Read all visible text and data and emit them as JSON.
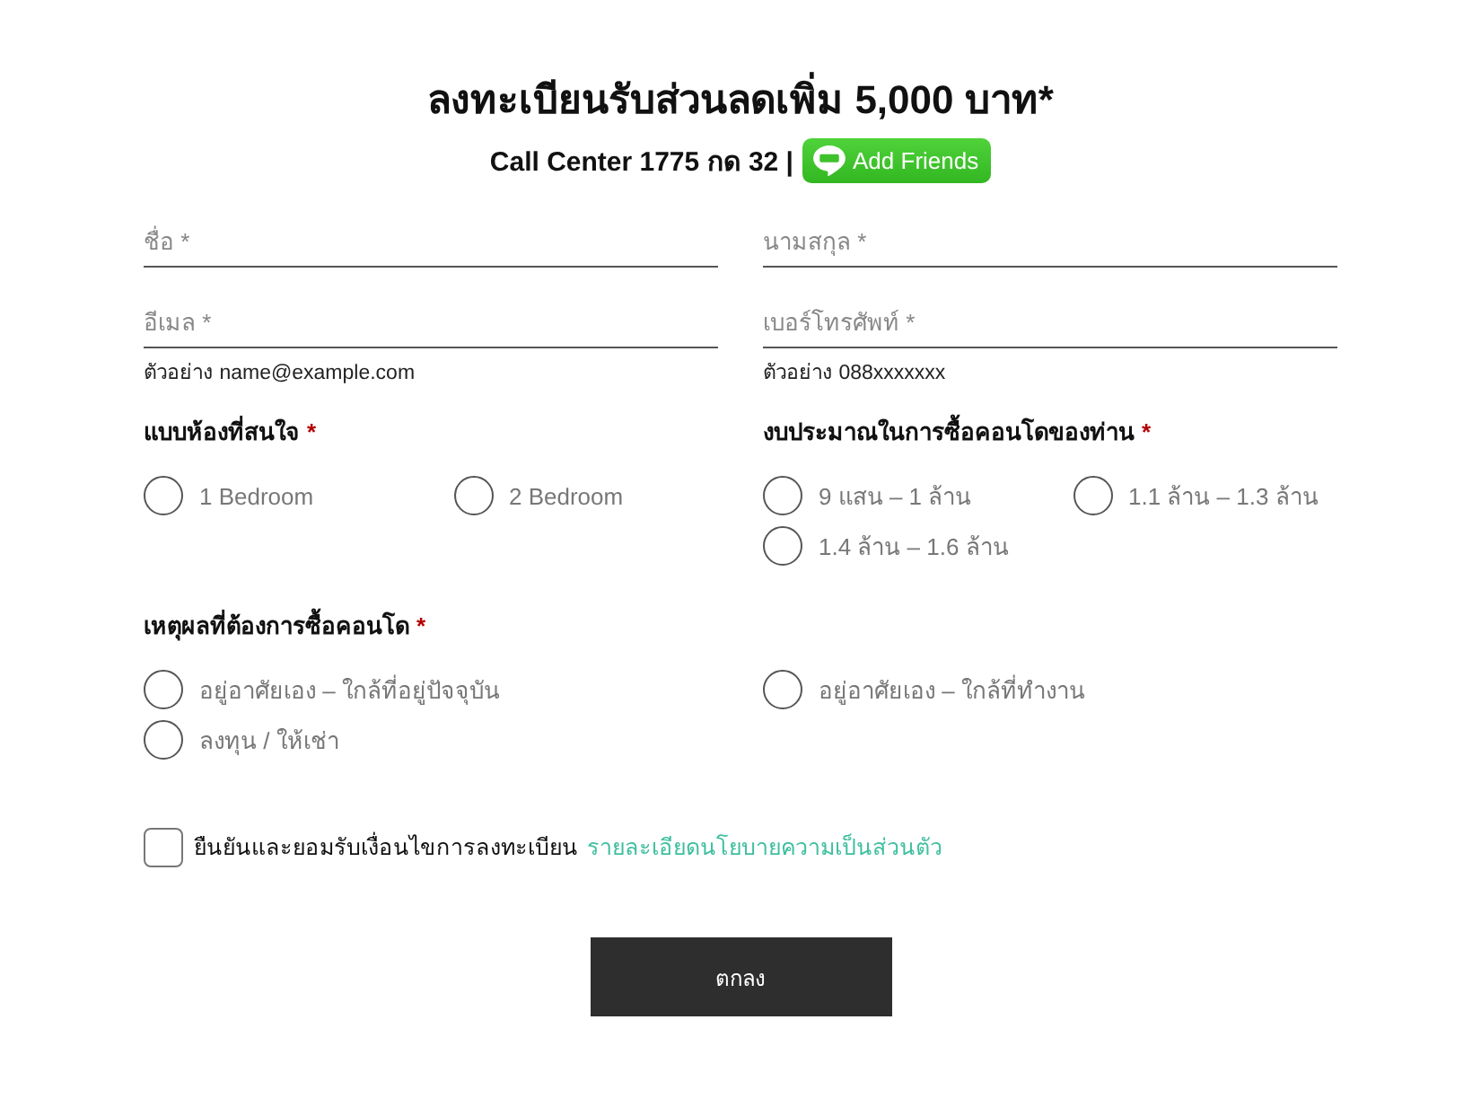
{
  "title": "ลงทะเบียนรับส่วนลดเพิ่ม 5,000 บาท*",
  "contact": {
    "text": "Call Center 1775 กด 32 |",
    "button": "Add Friends"
  },
  "fields": [
    {
      "placeholder": "ชื่อ *"
    },
    {
      "placeholder": "นามสกุล *"
    },
    {
      "placeholder": "อีเมล *",
      "hint": "ตัวอย่าง name@example.com"
    },
    {
      "placeholder": "เบอร์โทรศัพท์ *",
      "hint": "ตัวอย่าง 088xxxxxxx"
    }
  ],
  "question_rows": [
    {
      "questions": [
        {
          "heading": "แบบห้องที่สนใจ",
          "required_mark": "*",
          "options": [
            {
              "label": "1 Bedroom",
              "selected": false
            },
            {
              "label": "2 Bedroom",
              "selected": false
            }
          ]
        },
        {
          "heading": "งบประมาณในการซื้อคอนโดของท่าน",
          "required_mark": "*",
          "options": [
            {
              "label": "9 แสน – 1 ล้าน",
              "selected": false
            },
            {
              "label": "1.1 ล้าน – 1.3 ล้าน",
              "selected": false
            },
            {
              "label": "1.4 ล้าน – 1.6 ล้าน",
              "selected": false
            }
          ]
        }
      ]
    },
    {
      "questions": [
        {
          "heading": "เหตุผลที่ต้องการซื้อคอนโด",
          "required_mark": "*",
          "options": [
            {
              "label": "อยู่อาศัยเอง – ใกล้ที่อยู่ปัจจุบัน",
              "selected": false
            },
            {
              "label": "อยู่อาศัยเอง – ใกล้ที่ทำงาน",
              "selected": false
            },
            {
              "label": "ลงทุน / ให้เช่า",
              "selected": false
            }
          ]
        }
      ]
    }
  ],
  "consent": {
    "checked": false,
    "text": "ยืนยันและยอมรับเงื่อนไขการลงทะเบียน",
    "link": "รายละเอียดนโยบายความเป็นส่วนตัว"
  },
  "submit": "ตกลง"
}
